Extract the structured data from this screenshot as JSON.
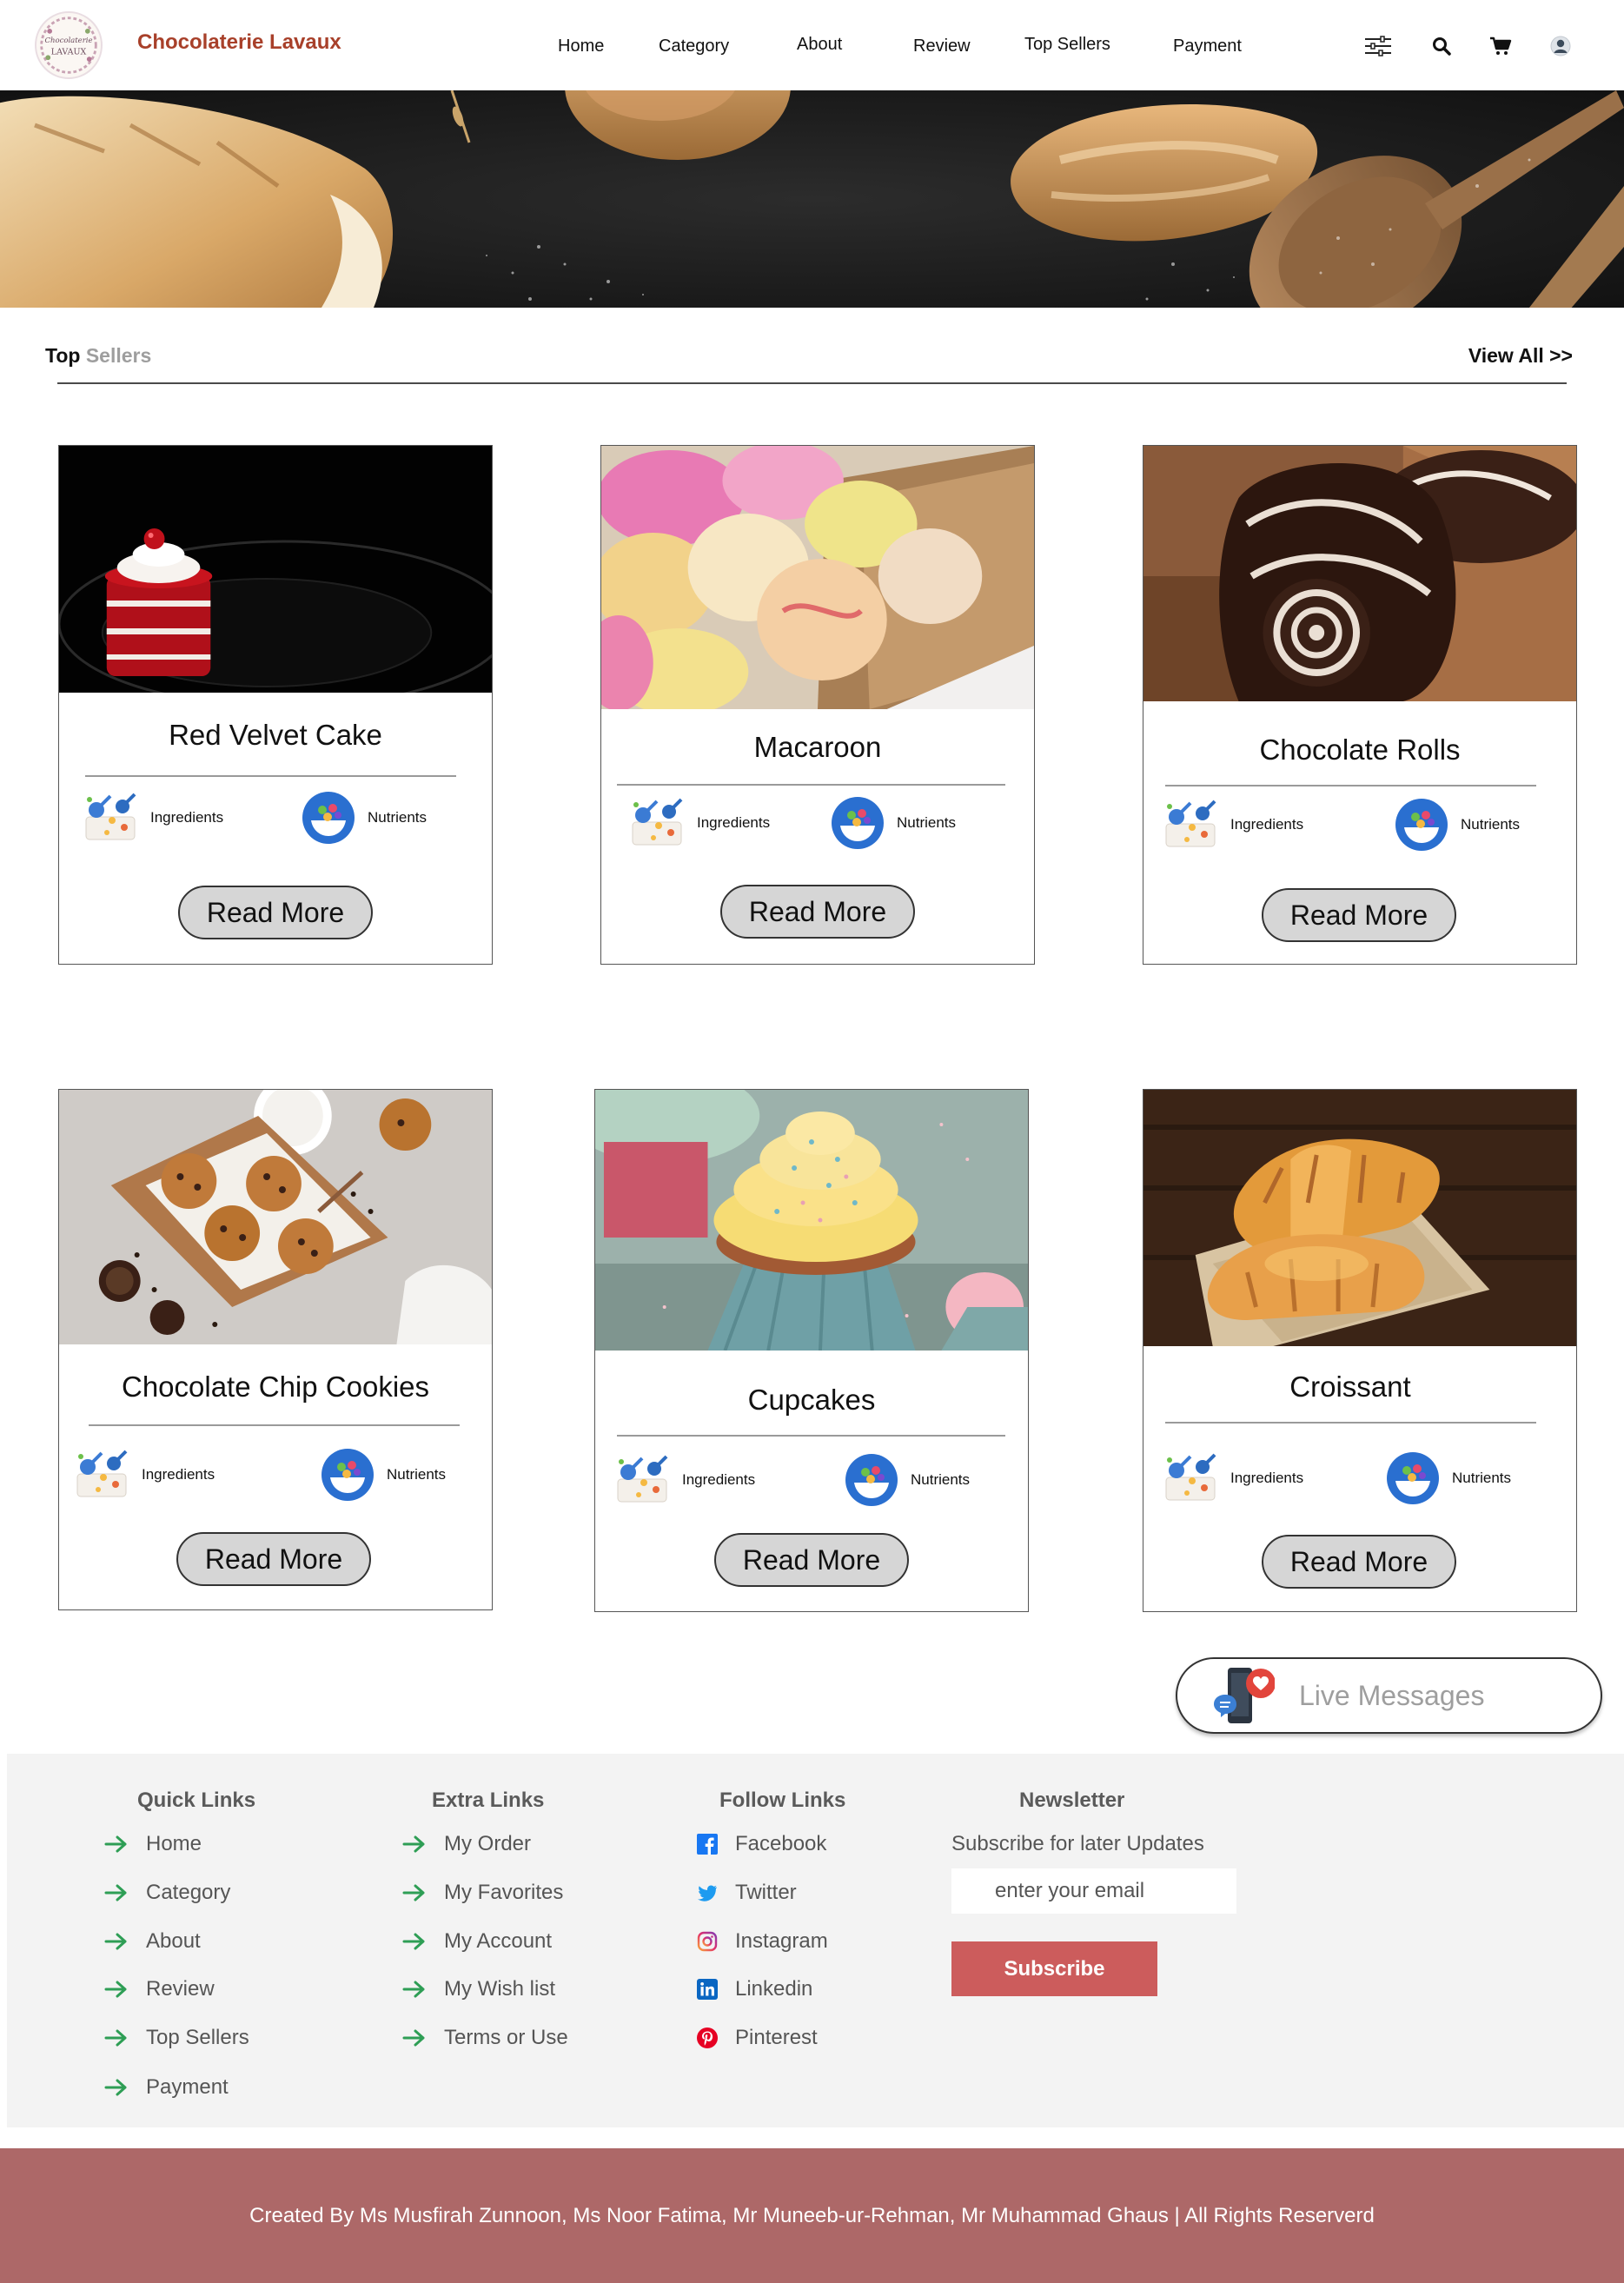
{
  "brand": {
    "name": "Chocolaterie Lavaux",
    "logo_text_top": "Chocolaterie",
    "logo_text_bottom": "LAVAUX"
  },
  "nav": {
    "links": [
      "Home",
      "Category",
      "About",
      "Review",
      "Top Sellers",
      "Payment"
    ],
    "icons": [
      "filter-icon",
      "search-icon",
      "cart-icon",
      "user-icon"
    ]
  },
  "section": {
    "title_part1": "Top",
    "title_part2": "Sellers",
    "view_all": "View All >>"
  },
  "products": [
    {
      "name": "Red Velvet Cake",
      "ingredients_label": "Ingredients",
      "nutrients_label": "Nutrients",
      "button": "Read More"
    },
    {
      "name": "Macaroon",
      "ingredients_label": "Ingredients",
      "nutrients_label": "Nutrients",
      "button": "Read More"
    },
    {
      "name": "Chocolate  Rolls",
      "ingredients_label": "Ingredients",
      "nutrients_label": "Nutrients",
      "button": "Read More"
    },
    {
      "name": "Chocolate Chip Cookies",
      "ingredients_label": "Ingredients",
      "nutrients_label": "Nutrients",
      "button": "Read More"
    },
    {
      "name": "Cupcakes",
      "ingredients_label": "Ingredients",
      "nutrients_label": "Nutrients",
      "button": "Read More"
    },
    {
      "name": "Croissant",
      "ingredients_label": "Ingredients",
      "nutrients_label": "Nutrients",
      "button": "Read More"
    }
  ],
  "live_messages": {
    "label": "Live Messages"
  },
  "footer": {
    "quick_links": {
      "title": "Quick Links",
      "items": [
        "Home",
        "Category",
        "About",
        "Review",
        "Top Sellers",
        "Payment"
      ]
    },
    "extra_links": {
      "title": "Extra Links",
      "items": [
        "My Order",
        "My Favorites",
        "My Account",
        "My Wish list",
        "Terms or Use"
      ]
    },
    "follow_links": {
      "title": "Follow Links",
      "items": [
        "Facebook",
        "Twitter",
        "Instagram",
        "Linkedin",
        "Pinterest"
      ]
    },
    "newsletter": {
      "title": "Newsletter",
      "subtitle": "Subscribe for later Updates",
      "placeholder": "enter your email",
      "button": "Subscribe"
    }
  },
  "credits": "Created By Ms Musfirah Zunnoon, Ms Noor Fatima, Mr Muneeb-ur-Rehman, Mr Muhammad Ghaus | All Rights Reserverd",
  "colors": {
    "brand": "#a8402a",
    "subscribe": "#cc5c5c",
    "credits_bar": "#ad6868",
    "arrow": "#2e9e55",
    "button_bg": "#d6d6d6"
  }
}
